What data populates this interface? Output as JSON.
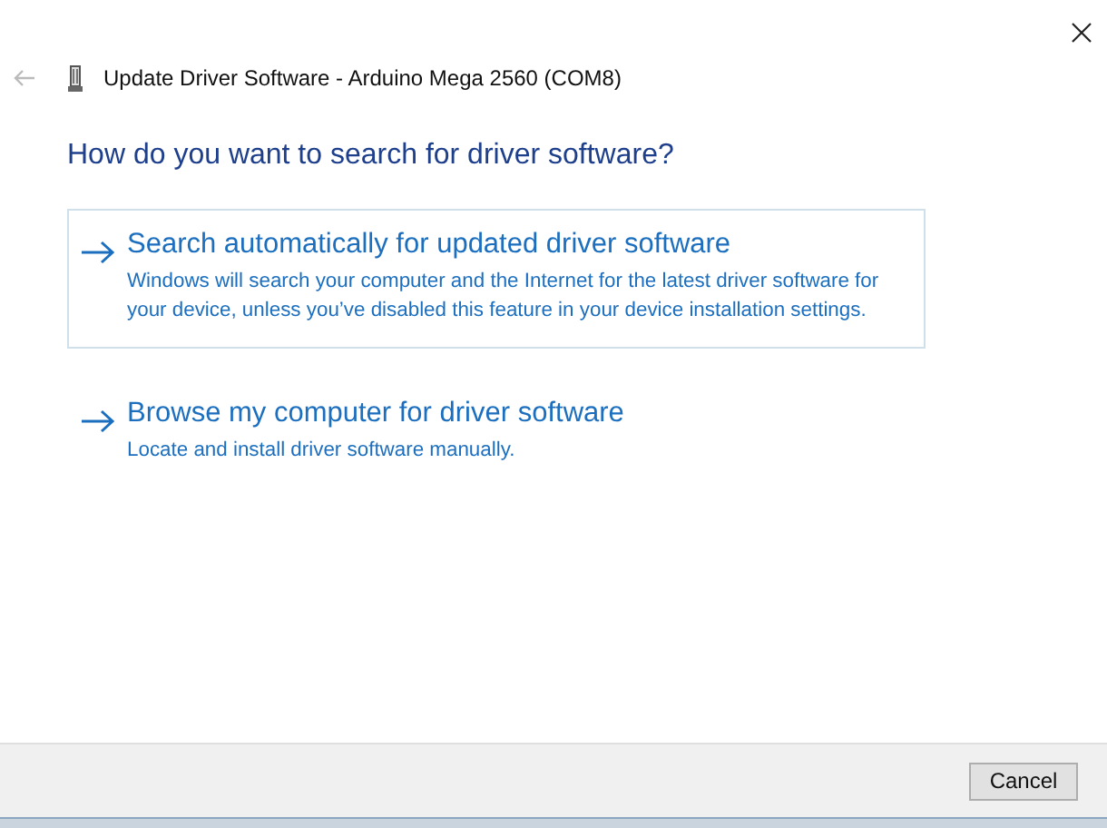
{
  "window": {
    "title": "Update Driver Software - Arduino Mega 2560 (COM8)"
  },
  "heading": "How do you want to search for driver software?",
  "options": [
    {
      "title": "Search automatically for updated driver software",
      "description": "Windows will search your computer and the Internet for the latest driver software for your device, unless you’ve disabled this feature in your device installation settings.",
      "selected": true
    },
    {
      "title": "Browse my computer for driver software",
      "description": "Locate and install driver software manually.",
      "selected": false
    }
  ],
  "buttons": [
    "Cancel"
  ]
}
